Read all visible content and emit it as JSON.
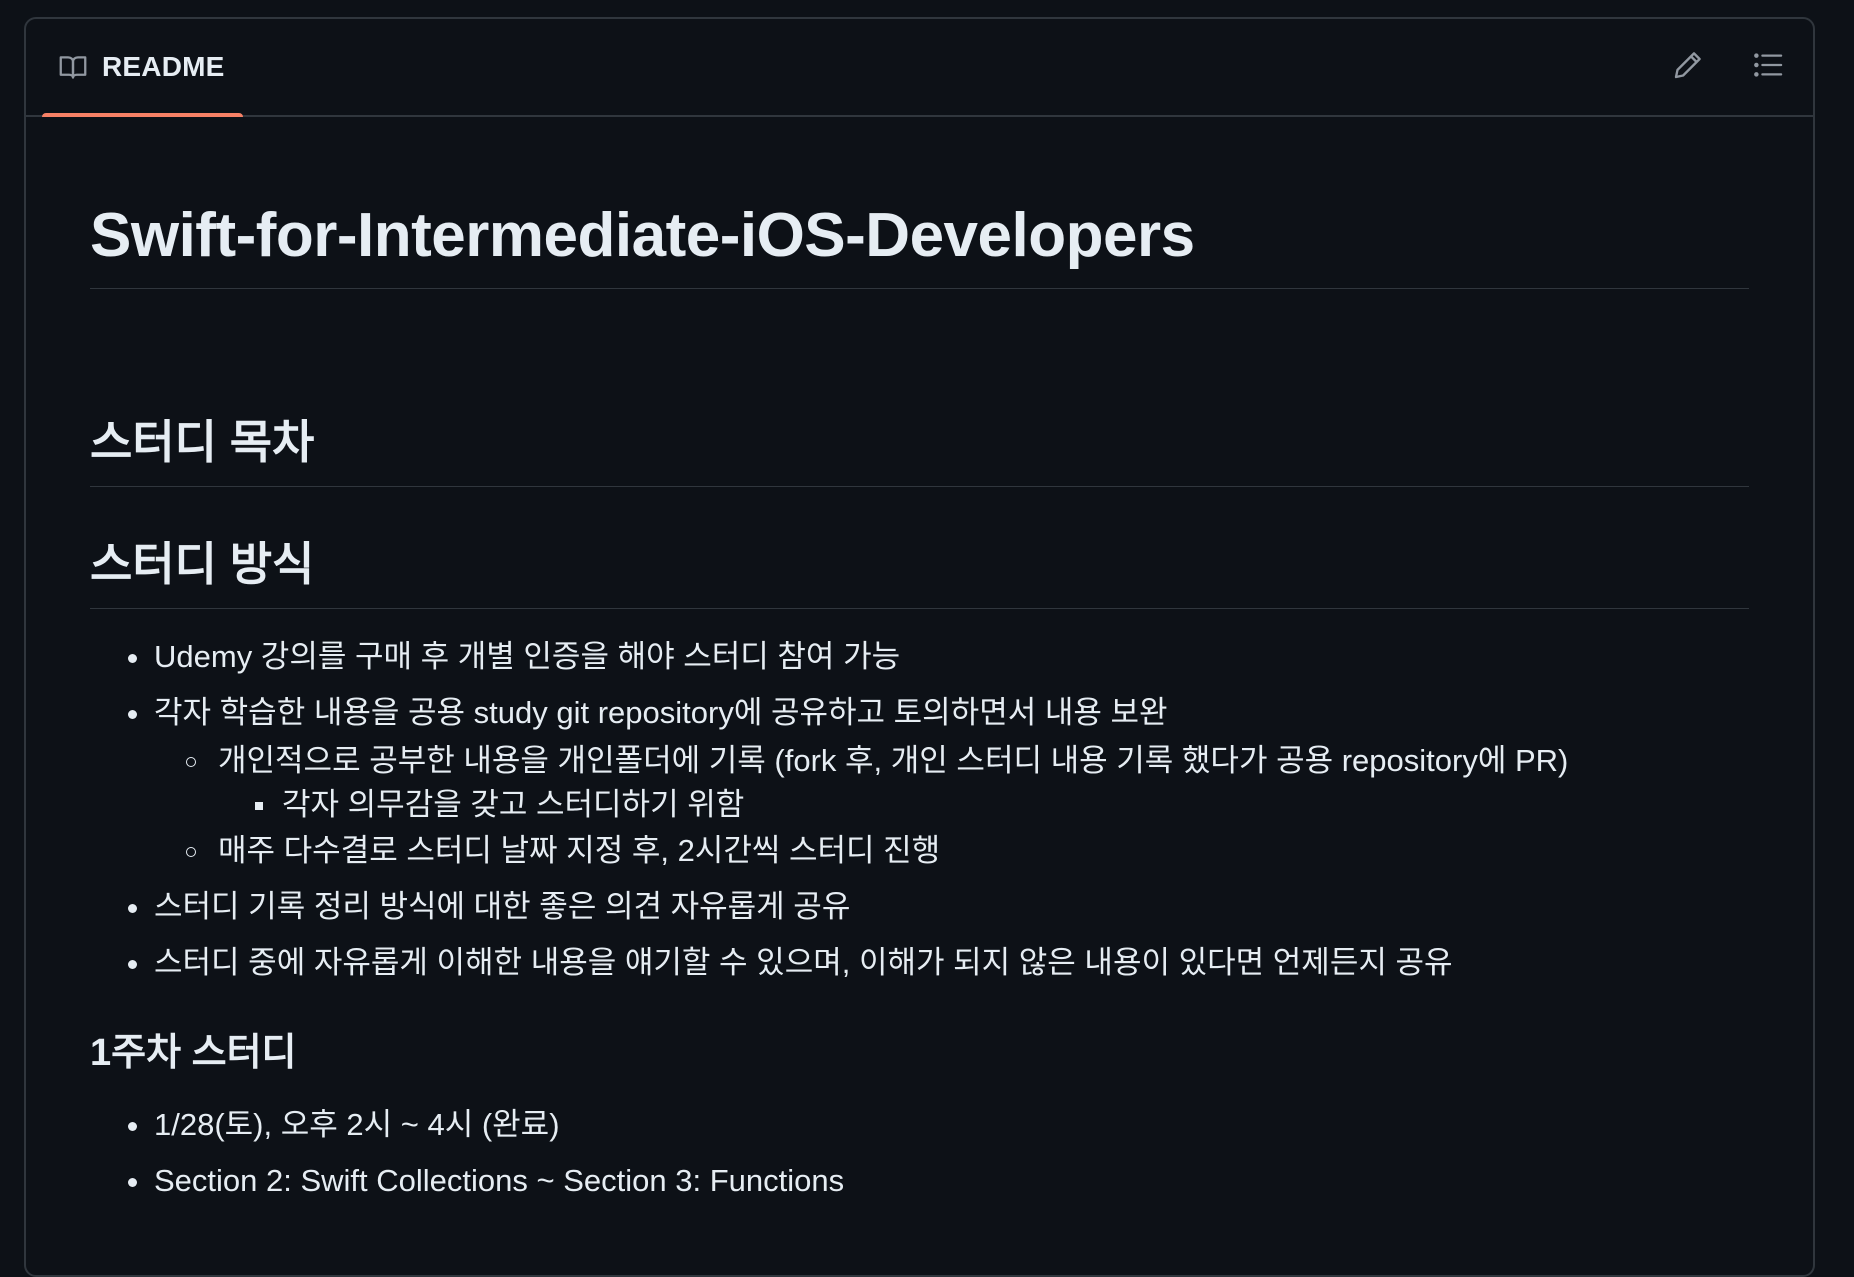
{
  "readme_tab": {
    "label": "README",
    "icon": "book-icon"
  },
  "actions": {
    "edit_icon": "pencil-icon",
    "outline_icon": "list-unordered-icon"
  },
  "colors": {
    "background": "#0d1117",
    "border": "#30363d",
    "text": "#e6edf3",
    "tab_underline": "#f78166"
  },
  "content": {
    "title": "Swift-for-Intermediate-iOS-Developers",
    "toc_heading": "스터디 목차",
    "method_heading": "스터디 방식",
    "method_items": [
      "Udemy 강의를 구매 후 개별 인증을 해야 스터디 참여 가능",
      "각자 학습한 내용을 공용 study git repository에 공유하고 토의하면서 내용 보완",
      "스터디 기록 정리 방식에 대한 좋은 의견 자유롭게 공유",
      "스터디 중에 자유롭게 이해한 내용을 얘기할 수 있으며, 이해가 되지 않은 내용이 있다면 언제든지 공유"
    ],
    "method_subitems": [
      "개인적으로 공부한 내용을 개인폴더에 기록 (fork 후, 개인 스터디 내용 기록 했다가 공용 repository에 PR)",
      "매주 다수결로 스터디 날짜 지정 후, 2시간씩 스터디 진행"
    ],
    "method_subsubitems": [
      "각자 의무감을 갖고 스터디하기 위함"
    ],
    "week1_heading": "1주차 스터디",
    "week1_items": [
      "1/28(토), 오후 2시 ~ 4시 (완료)",
      "Section 2: Swift Collections ~ Section 3: Functions"
    ]
  }
}
